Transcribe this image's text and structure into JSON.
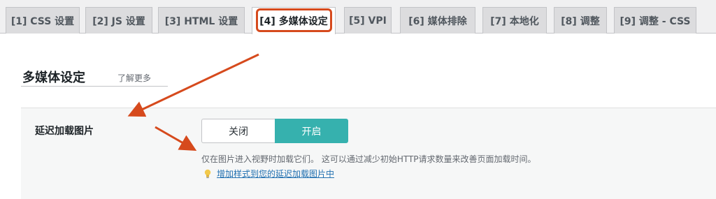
{
  "tabs": [
    {
      "label": "[1] CSS 设置"
    },
    {
      "label": "[2] JS 设置"
    },
    {
      "label": "[3] HTML 设置"
    },
    {
      "label": "[4] 多媒体设定"
    },
    {
      "label": "[5] VPI"
    },
    {
      "label": "[6] 媒体排除"
    },
    {
      "label": "[7] 本地化"
    },
    {
      "label": "[8] 调整"
    },
    {
      "label": "[9] 调整 - CSS"
    }
  ],
  "active_tab_index": 3,
  "section": {
    "title": "多媒体设定",
    "learn_more": "了解更多"
  },
  "setting": {
    "label": "延迟加载图片",
    "toggle_off": "关闭",
    "toggle_on": "开启",
    "selected": "开启",
    "description": "仅在图片进入视野时加载它们。 这可以通过减少初始HTTP请求数量来改善页面加载时间。",
    "tip_link": "增加样式到您的延迟加载图片中"
  },
  "colors": {
    "accent_teal": "#36b1ae",
    "annotation_red": "#d64a1d",
    "link_blue": "#2271b1"
  },
  "icons": {
    "tip": "lightbulb-icon"
  }
}
